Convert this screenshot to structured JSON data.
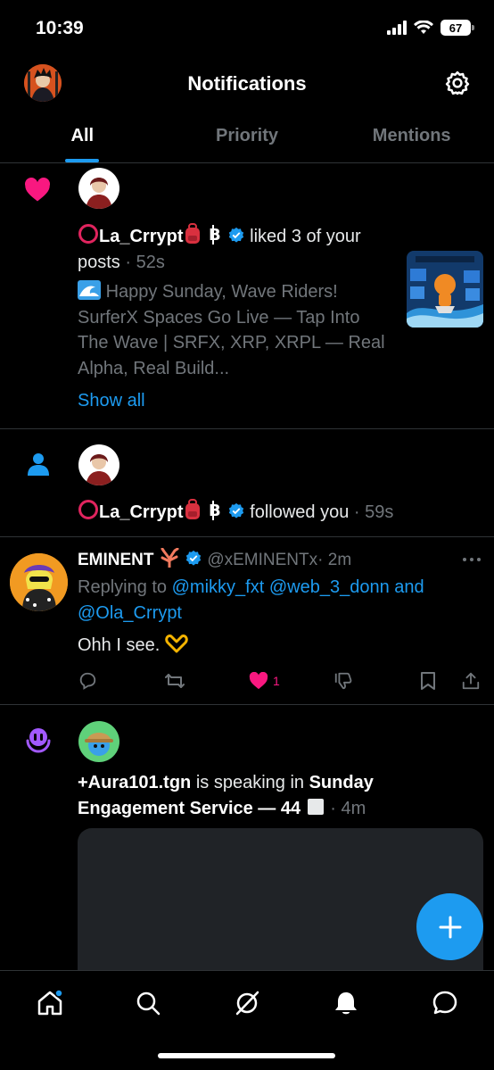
{
  "status_bar": {
    "time": "10:39",
    "battery": "67"
  },
  "header": {
    "title": "Notifications"
  },
  "tabs": [
    {
      "label": "All",
      "active": true
    },
    {
      "label": "Priority",
      "active": false
    },
    {
      "label": "Mentions",
      "active": false
    }
  ],
  "notifications": {
    "like": {
      "user": "La_Crrypt",
      "action": "liked 3 of your",
      "action_cont": "posts",
      "time": "· 52s",
      "preview_lines": [
        "Happy Sunday, Wave Riders!",
        "SurferX Spaces Go Live — Tap Into",
        "The Wave | SRFX, XRP, XRPL — Real",
        "Alpha, Real Build..."
      ],
      "show_all": "Show all"
    },
    "follow": {
      "user": "La_Crrypt",
      "action": "followed you",
      "time": "· 59s"
    },
    "reply": {
      "name": "EMINENT",
      "handle": "@xEMINENTx",
      "time": "· 2m",
      "replying_to_label": "Replying to",
      "mention_1": "@mikky_fxt",
      "mention_2": "@web_3_donn",
      "and": "and",
      "mention_3": "@Ola_Crrypt",
      "text": "Ohh I see.",
      "like_count": "1"
    },
    "space": {
      "user": "+Aura101.tgn",
      "action": "is speaking in",
      "space_name_1": "Sunday",
      "space_name_2": "Engagement Service — 44",
      "time": "· 4m"
    }
  },
  "colors": {
    "accent": "#1d9bf0",
    "like": "#f91880",
    "spaces": "#a259ff",
    "background": "#000000"
  }
}
